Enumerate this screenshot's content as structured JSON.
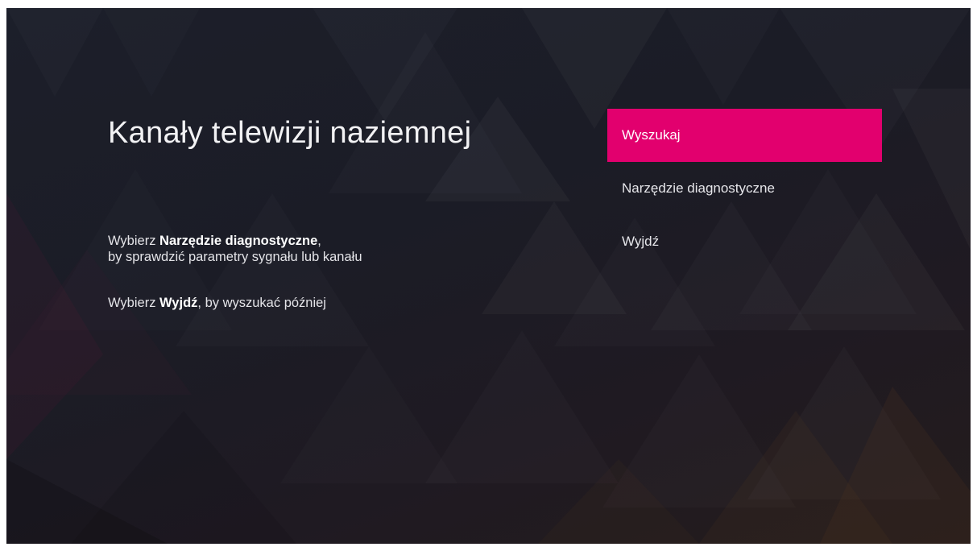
{
  "screen": {
    "title": "Kanały telewizji naziemnej",
    "instruction1": {
      "prefix": "Wybierz ",
      "bold": "Narzędzie diagnostyczne",
      "suffix": ",",
      "line2": "by sprawdzić parametry sygnału lub kanału"
    },
    "instruction2": {
      "prefix": "Wybierz ",
      "bold": "Wyjdź",
      "suffix": ", by wyszukać później"
    }
  },
  "menu": {
    "items": [
      {
        "label": "Wyszukaj",
        "selected": true
      },
      {
        "label": "Narzędzie diagnostyczne",
        "selected": false
      },
      {
        "label": "Wyjdź",
        "selected": false
      }
    ]
  },
  "colors": {
    "accent": "#e2006e",
    "background": "#1c1d27",
    "text": "#ffffff"
  }
}
